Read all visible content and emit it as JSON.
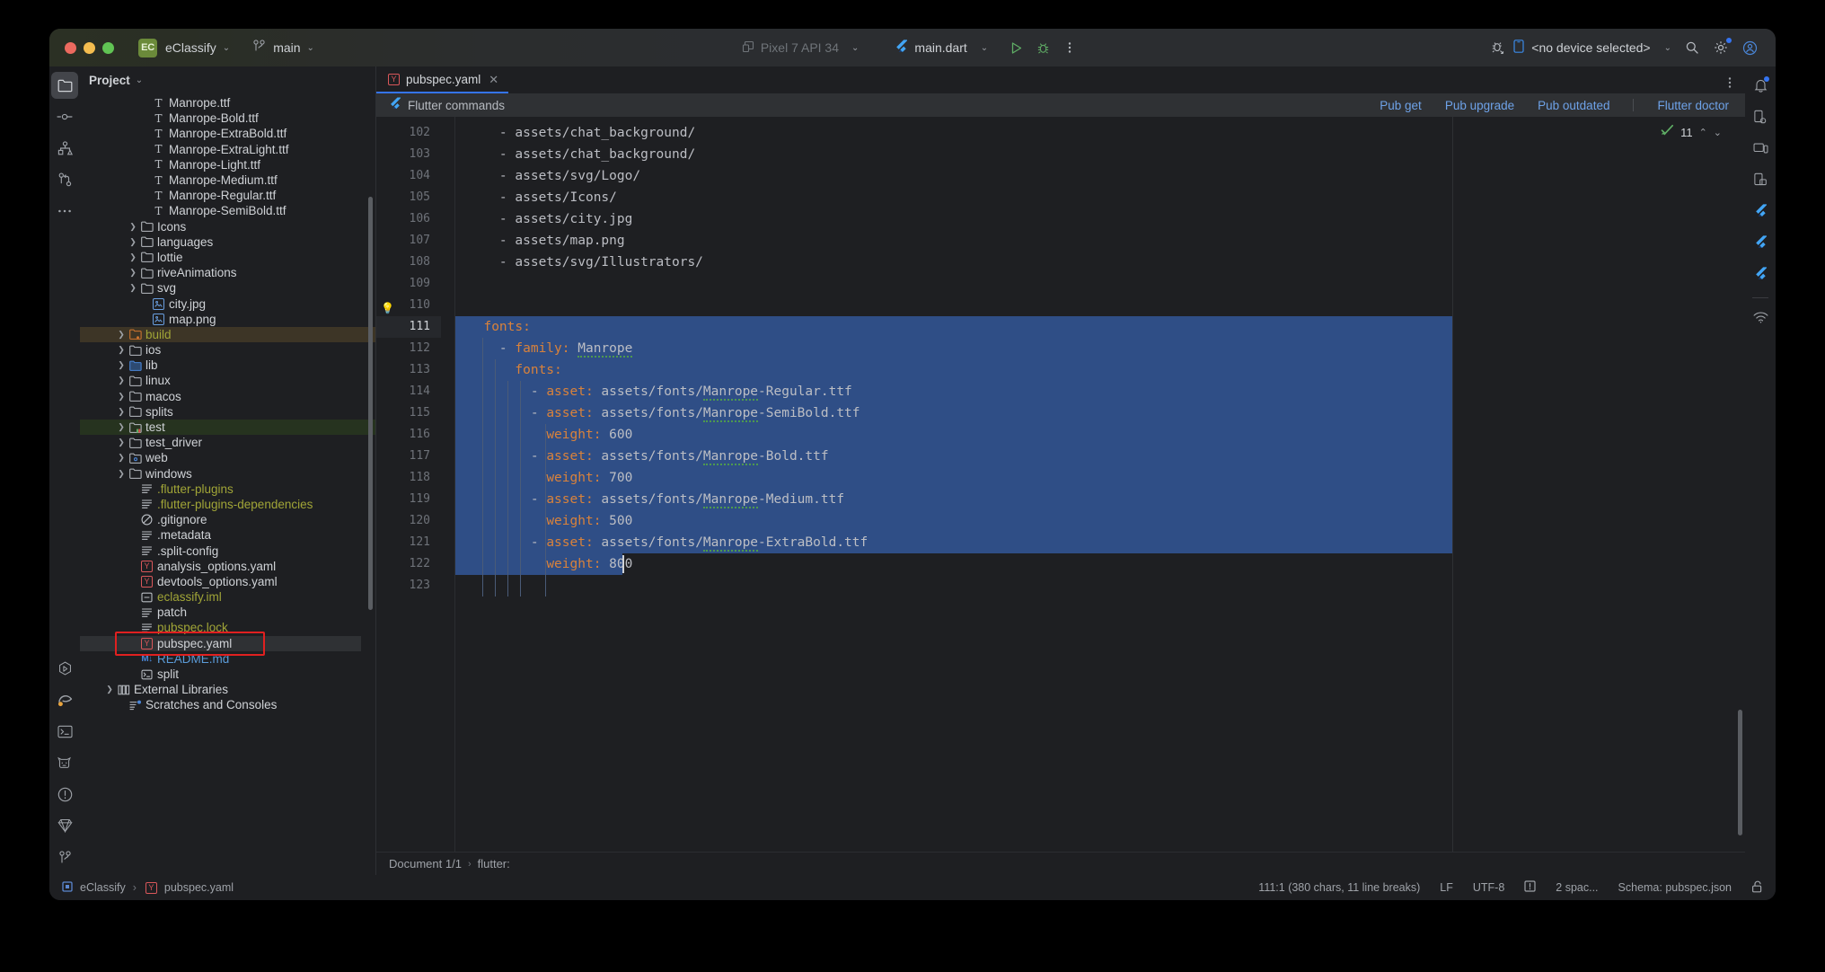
{
  "window": {
    "project_badge": "EC",
    "project_name": "eClassify",
    "branch": "main",
    "branch_icon": "git-branch-icon"
  },
  "toolbar": {
    "device_selector": "Pixel 7 API 34",
    "run_config": "main.dart",
    "run_icon": "run-icon",
    "debug_icon": "debug-icon",
    "more_icon": "more-vertical-icon",
    "profile_icon": "profile-debug-icon",
    "device_target": "<no device selected>",
    "search_icon": "search-icon",
    "settings_icon": "gear-icon",
    "account_icon": "account-icon"
  },
  "left_rail": {
    "items": [
      {
        "name": "project-tool-window",
        "icon": "folder-icon",
        "active": true
      },
      {
        "name": "commit-tool-window",
        "icon": "commit-icon",
        "active": false
      },
      {
        "name": "structure-tool-window",
        "icon": "structure-icon",
        "active": false
      },
      {
        "name": "pull-requests-tool-window",
        "icon": "pull-request-icon",
        "active": false
      },
      {
        "name": "more-tool-windows",
        "icon": "more-horizontal-icon",
        "active": false
      }
    ],
    "bottom_items": [
      {
        "name": "run-tool-window",
        "icon": "run-hex-icon"
      },
      {
        "name": "gradle-tool-window",
        "icon": "gradle-elephant-icon"
      },
      {
        "name": "terminal-tool-window",
        "icon": "terminal-icon"
      },
      {
        "name": "logcat-tool-window",
        "icon": "logcat-cat-icon"
      },
      {
        "name": "problems-tool-window",
        "icon": "warning-circle-icon"
      },
      {
        "name": "dart-analysis-tool-window",
        "icon": "dart-diamond-icon"
      },
      {
        "name": "version-control-tool-window",
        "icon": "git-branch-icon"
      }
    ]
  },
  "right_rail": {
    "items": [
      {
        "name": "notifications",
        "icon": "bell-icon",
        "badge": true
      },
      {
        "name": "device-manager",
        "icon": "device-manager-icon",
        "badge": false
      },
      {
        "name": "running-devices",
        "icon": "running-devices-icon",
        "badge": false
      },
      {
        "name": "device-mirroring",
        "icon": "device-mirroring-icon",
        "badge": false
      },
      {
        "name": "flutter-inspector",
        "icon": "flutter-icon",
        "badge": false
      },
      {
        "name": "flutter-outline",
        "icon": "flutter-icon",
        "badge": false
      },
      {
        "name": "flutter-performance",
        "icon": "flutter-icon",
        "badge": false
      },
      {
        "name": "app-quality-insights",
        "icon": "wifi-icon",
        "badge": false
      }
    ]
  },
  "project_panel": {
    "title": "Project",
    "chevron": "chevron-down-icon",
    "tree": [
      {
        "label": "Manrope.ttf",
        "indent": 5,
        "icon": "ttf-file-icon",
        "arrow": false,
        "color": "default"
      },
      {
        "label": "Manrope-Bold.ttf",
        "indent": 5,
        "icon": "ttf-file-icon",
        "arrow": false,
        "color": "default"
      },
      {
        "label": "Manrope-ExtraBold.ttf",
        "indent": 5,
        "icon": "ttf-file-icon",
        "arrow": false,
        "color": "default"
      },
      {
        "label": "Manrope-ExtraLight.ttf",
        "indent": 5,
        "icon": "ttf-file-icon",
        "arrow": false,
        "color": "default"
      },
      {
        "label": "Manrope-Light.ttf",
        "indent": 5,
        "icon": "ttf-file-icon",
        "arrow": false,
        "color": "default"
      },
      {
        "label": "Manrope-Medium.ttf",
        "indent": 5,
        "icon": "ttf-file-icon",
        "arrow": false,
        "color": "default"
      },
      {
        "label": "Manrope-Regular.ttf",
        "indent": 5,
        "icon": "ttf-file-icon",
        "arrow": false,
        "color": "default"
      },
      {
        "label": "Manrope-SemiBold.ttf",
        "indent": 5,
        "icon": "ttf-file-icon",
        "arrow": false,
        "color": "default"
      },
      {
        "label": "Icons",
        "indent": 4,
        "icon": "folder-icon",
        "arrow": true,
        "color": "default"
      },
      {
        "label": "languages",
        "indent": 4,
        "icon": "folder-icon",
        "arrow": true,
        "color": "default"
      },
      {
        "label": "lottie",
        "indent": 4,
        "icon": "folder-icon",
        "arrow": true,
        "color": "default"
      },
      {
        "label": "riveAnimations",
        "indent": 4,
        "icon": "folder-icon",
        "arrow": true,
        "color": "default"
      },
      {
        "label": "svg",
        "indent": 4,
        "icon": "folder-icon",
        "arrow": true,
        "color": "default"
      },
      {
        "label": "city.jpg",
        "indent": 5,
        "icon": "image-file-icon",
        "arrow": false,
        "color": "default"
      },
      {
        "label": "map.png",
        "indent": 5,
        "icon": "image-file-icon",
        "arrow": false,
        "color": "default"
      },
      {
        "label": "build",
        "indent": 3,
        "icon": "folder-excluded-icon",
        "arrow": true,
        "color": "yellow",
        "row_highlight": "build"
      },
      {
        "label": "ios",
        "indent": 3,
        "icon": "folder-icon",
        "arrow": true,
        "color": "default"
      },
      {
        "label": "lib",
        "indent": 3,
        "icon": "folder-source-icon",
        "arrow": true,
        "color": "default"
      },
      {
        "label": "linux",
        "indent": 3,
        "icon": "folder-icon",
        "arrow": true,
        "color": "default"
      },
      {
        "label": "macos",
        "indent": 3,
        "icon": "folder-icon",
        "arrow": true,
        "color": "default"
      },
      {
        "label": "splits",
        "indent": 3,
        "icon": "folder-icon",
        "arrow": true,
        "color": "default"
      },
      {
        "label": "test",
        "indent": 3,
        "icon": "folder-test-icon",
        "arrow": true,
        "color": "default",
        "row_highlight": "test"
      },
      {
        "label": "test_driver",
        "indent": 3,
        "icon": "folder-icon",
        "arrow": true,
        "color": "default"
      },
      {
        "label": "web",
        "indent": 3,
        "icon": "folder-web-icon",
        "arrow": true,
        "color": "default"
      },
      {
        "label": "windows",
        "indent": 3,
        "icon": "folder-icon",
        "arrow": true,
        "color": "default"
      },
      {
        "label": ".flutter-plugins",
        "indent": 4,
        "icon": "text-file-icon",
        "arrow": false,
        "color": "yellow"
      },
      {
        "label": ".flutter-plugins-dependencies",
        "indent": 4,
        "icon": "text-file-icon",
        "arrow": false,
        "color": "yellow"
      },
      {
        "label": ".gitignore",
        "indent": 4,
        "icon": "gitignore-icon",
        "arrow": false,
        "color": "default"
      },
      {
        "label": ".metadata",
        "indent": 4,
        "icon": "text-file-icon",
        "arrow": false,
        "color": "default"
      },
      {
        "label": ".split-config",
        "indent": 4,
        "icon": "text-file-icon",
        "arrow": false,
        "color": "default"
      },
      {
        "label": "analysis_options.yaml",
        "indent": 4,
        "icon": "yaml-file-icon",
        "arrow": false,
        "color": "default"
      },
      {
        "label": "devtools_options.yaml",
        "indent": 4,
        "icon": "yaml-file-icon",
        "arrow": false,
        "color": "default"
      },
      {
        "label": "eclassify.iml",
        "indent": 4,
        "icon": "iml-file-icon",
        "arrow": false,
        "color": "yellow"
      },
      {
        "label": "patch",
        "indent": 4,
        "icon": "text-file-icon",
        "arrow": false,
        "color": "default"
      },
      {
        "label": "pubspec.lock",
        "indent": 4,
        "icon": "text-file-icon",
        "arrow": false,
        "color": "yellow"
      },
      {
        "label": "pubspec.yaml",
        "indent": 4,
        "icon": "yaml-file-icon",
        "arrow": false,
        "color": "default",
        "row_highlight": "selected",
        "annotated": true
      },
      {
        "label": "README.md",
        "indent": 4,
        "icon": "markdown-file-icon",
        "arrow": false,
        "color": "blue"
      },
      {
        "label": "split",
        "indent": 4,
        "icon": "shell-file-icon",
        "arrow": false,
        "color": "default"
      },
      {
        "label": "External Libraries",
        "indent": 2,
        "icon": "library-icon",
        "arrow": true,
        "color": "default"
      },
      {
        "label": "Scratches and Consoles",
        "indent": 3,
        "icon": "scratches-icon",
        "arrow": false,
        "color": "default"
      }
    ]
  },
  "editor": {
    "tab": {
      "label": "pubspec.yaml",
      "icon": "yaml-file-icon",
      "close_icon": "close-icon"
    },
    "tab_options_icon": "more-vertical-icon",
    "notification": {
      "icon": "flutter-icon",
      "text": "Flutter commands",
      "actions": [
        "Pub get",
        "Pub upgrade",
        "Pub outdated",
        "Flutter doctor"
      ]
    },
    "inspection_widget": {
      "icon": "inspection-ok-icon",
      "count": "11",
      "prev_icon": "chevron-up-icon",
      "next_icon": "chevron-down-icon"
    },
    "first_line_number": 102,
    "lines": [
      {
        "n": 102,
        "indent": 4,
        "tokens": [
          {
            "t": "- ",
            "c": "p"
          },
          {
            "t": "assets/chat_background/",
            "c": "s"
          }
        ]
      },
      {
        "n": 103,
        "indent": 4,
        "tokens": [
          {
            "t": "- ",
            "c": "p"
          },
          {
            "t": "assets/chat_background/",
            "c": "s"
          }
        ]
      },
      {
        "n": 104,
        "indent": 4,
        "tokens": [
          {
            "t": "- ",
            "c": "p"
          },
          {
            "t": "assets/svg/Logo/",
            "c": "s"
          }
        ]
      },
      {
        "n": 105,
        "indent": 4,
        "tokens": [
          {
            "t": "- ",
            "c": "p"
          },
          {
            "t": "assets/Icons/",
            "c": "s"
          }
        ]
      },
      {
        "n": 106,
        "indent": 4,
        "tokens": [
          {
            "t": "- ",
            "c": "p"
          },
          {
            "t": "assets/city.jpg",
            "c": "s"
          }
        ]
      },
      {
        "n": 107,
        "indent": 4,
        "tokens": [
          {
            "t": "- ",
            "c": "p"
          },
          {
            "t": "assets/map.png",
            "c": "s"
          }
        ]
      },
      {
        "n": 108,
        "indent": 4,
        "tokens": [
          {
            "t": "- ",
            "c": "p"
          },
          {
            "t": "assets/svg/Illustrators/",
            "c": "s"
          }
        ]
      },
      {
        "n": 109,
        "indent": 0,
        "tokens": []
      },
      {
        "n": 110,
        "indent": 0,
        "tokens": [],
        "bulb": true
      },
      {
        "n": 111,
        "indent": 2,
        "tokens": [
          {
            "t": "fonts:",
            "c": "k"
          }
        ],
        "current": true
      },
      {
        "n": 112,
        "indent": 4,
        "tokens": [
          {
            "t": "- ",
            "c": "p"
          },
          {
            "t": "family:",
            "c": "k"
          },
          {
            "t": " ",
            "c": "s"
          },
          {
            "t": "Manrope",
            "c": "s",
            "squiggle": true
          }
        ]
      },
      {
        "n": 113,
        "indent": 6,
        "tokens": [
          {
            "t": "fonts:",
            "c": "k"
          }
        ]
      },
      {
        "n": 114,
        "indent": 8,
        "tokens": [
          {
            "t": "- ",
            "c": "p"
          },
          {
            "t": "asset:",
            "c": "k"
          },
          {
            "t": " assets/fonts/",
            "c": "s"
          },
          {
            "t": "Manrope",
            "c": "s",
            "squiggle": true
          },
          {
            "t": "-Regular.ttf",
            "c": "s"
          }
        ]
      },
      {
        "n": 115,
        "indent": 8,
        "tokens": [
          {
            "t": "- ",
            "c": "p"
          },
          {
            "t": "asset:",
            "c": "k"
          },
          {
            "t": " assets/fonts/",
            "c": "s"
          },
          {
            "t": "Manrope",
            "c": "s",
            "squiggle": true
          },
          {
            "t": "-SemiBold.ttf",
            "c": "s"
          }
        ]
      },
      {
        "n": 116,
        "indent": 10,
        "tokens": [
          {
            "t": "weight:",
            "c": "k"
          },
          {
            "t": " 600",
            "c": "s"
          }
        ]
      },
      {
        "n": 117,
        "indent": 8,
        "tokens": [
          {
            "t": "- ",
            "c": "p"
          },
          {
            "t": "asset:",
            "c": "k"
          },
          {
            "t": " assets/fonts/",
            "c": "s"
          },
          {
            "t": "Manrope",
            "c": "s",
            "squiggle": true
          },
          {
            "t": "-Bold.ttf",
            "c": "s"
          }
        ]
      },
      {
        "n": 118,
        "indent": 10,
        "tokens": [
          {
            "t": "weight:",
            "c": "k"
          },
          {
            "t": " 700",
            "c": "s"
          }
        ]
      },
      {
        "n": 119,
        "indent": 8,
        "tokens": [
          {
            "t": "- ",
            "c": "p"
          },
          {
            "t": "asset:",
            "c": "k"
          },
          {
            "t": " assets/fonts/",
            "c": "s"
          },
          {
            "t": "Manrope",
            "c": "s",
            "squiggle": true
          },
          {
            "t": "-Medium.ttf",
            "c": "s"
          }
        ]
      },
      {
        "n": 120,
        "indent": 10,
        "tokens": [
          {
            "t": "weight:",
            "c": "k"
          },
          {
            "t": " 500",
            "c": "s"
          }
        ]
      },
      {
        "n": 121,
        "indent": 8,
        "tokens": [
          {
            "t": "- ",
            "c": "p"
          },
          {
            "t": "asset:",
            "c": "k"
          },
          {
            "t": " assets/fonts/",
            "c": "s"
          },
          {
            "t": "Manrope",
            "c": "s",
            "squiggle": true
          },
          {
            "t": "-ExtraBold.ttf",
            "c": "s"
          }
        ]
      },
      {
        "n": 122,
        "indent": 10,
        "tokens": [
          {
            "t": "weight:",
            "c": "k"
          },
          {
            "t": " 800",
            "c": "s"
          }
        ]
      },
      {
        "n": 123,
        "indent": 0,
        "tokens": []
      }
    ],
    "selection": {
      "from_line": 111,
      "to_line": 122
    },
    "breadcrumb": [
      "Document 1/1",
      "flutter:"
    ]
  },
  "statusbar": {
    "breadcrumb_project": "eClassify",
    "breadcrumb_file": "pubspec.yaml",
    "breadcrumb_file_icon": "yaml-file-icon",
    "caret_position": "111:1 (380 chars, 11 line breaks)",
    "line_separator": "LF",
    "encoding": "UTF-8",
    "inspection_icon": "inspections-icon",
    "indent": "2 spac...",
    "schema": "Schema: pubspec.json",
    "lock_icon": "unlocked-icon"
  },
  "colors": {
    "accent_blue": "#3574f0",
    "selection": "#2f4e86",
    "key_orange": "#d9823b",
    "link_blue": "#6ea2e8",
    "annotation_red": "#e02020"
  }
}
